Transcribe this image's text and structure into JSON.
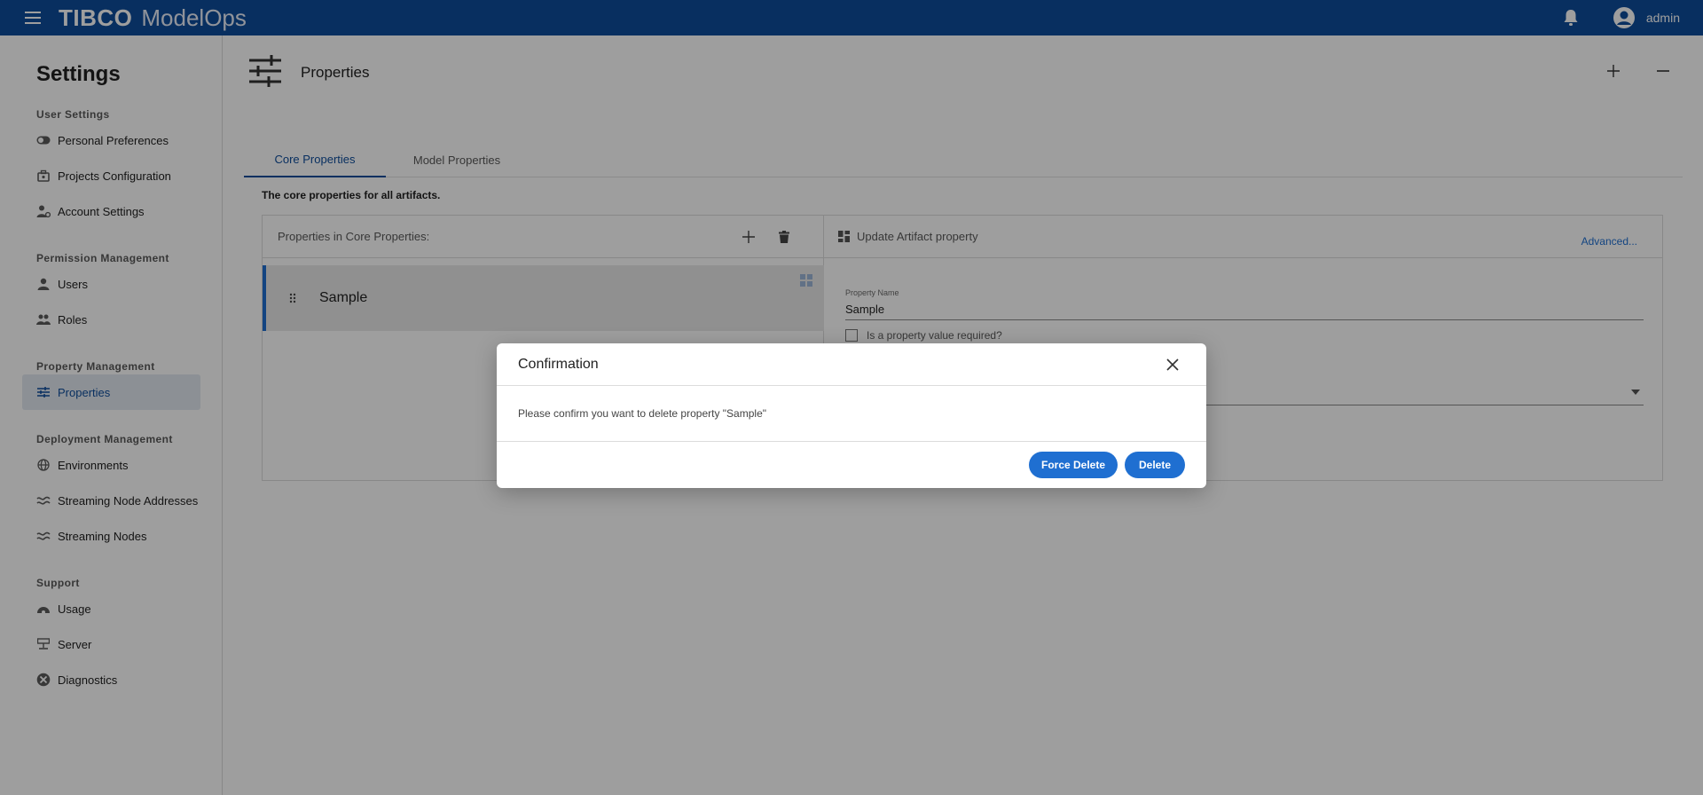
{
  "topbar": {
    "brand": "TIBCO",
    "product": "ModelOps",
    "user_name": "admin"
  },
  "sidebar": {
    "title": "Settings",
    "sections": [
      {
        "heading": "User Settings",
        "items": [
          {
            "label": "Personal Preferences",
            "icon": "toggle-icon"
          },
          {
            "label": "Projects Configuration",
            "icon": "briefcase-icon"
          },
          {
            "label": "Account Settings",
            "icon": "user-gear-icon"
          }
        ]
      },
      {
        "heading": "Permission Management",
        "items": [
          {
            "label": "Users",
            "icon": "person-icon"
          },
          {
            "label": "Roles",
            "icon": "people-icon"
          }
        ]
      },
      {
        "heading": "Property Management",
        "items": [
          {
            "label": "Properties",
            "icon": "sliders-icon",
            "active": true
          }
        ]
      },
      {
        "heading": "Deployment Management",
        "items": [
          {
            "label": "Environments",
            "icon": "globe-icon"
          },
          {
            "label": "Streaming Node Addresses",
            "icon": "wave-icon"
          },
          {
            "label": "Streaming Nodes",
            "icon": "wave-icon"
          }
        ]
      },
      {
        "heading": "Support",
        "items": [
          {
            "label": "Usage",
            "icon": "gauge-icon"
          },
          {
            "label": "Server",
            "icon": "server-icon"
          },
          {
            "label": "Diagnostics",
            "icon": "diagnostics-icon"
          }
        ]
      }
    ]
  },
  "main": {
    "page_title": "Properties",
    "tabs": [
      {
        "label": "Core Properties",
        "active": true
      },
      {
        "label": "Model Properties",
        "active": false
      }
    ],
    "description": "The core properties for all artifacts.",
    "left_panel": {
      "heading": "Properties in Core Properties:",
      "items": [
        {
          "label": "Sample",
          "selected": true
        }
      ]
    },
    "right_panel": {
      "heading": "Update Artifact property",
      "advanced_link": "Advanced...",
      "property_name_label": "Property Name",
      "property_name_value": "Sample",
      "required_checkbox_label": "Is a property value required?"
    }
  },
  "dialog": {
    "title": "Confirmation",
    "message": "Please confirm you want to delete property \"Sample\"",
    "force_delete_label": "Force Delete",
    "delete_label": "Delete"
  },
  "colors": {
    "topbar": "#0e4d9c",
    "accent": "#1f6fd1",
    "overlay": "rgba(0,0,0,0.38)"
  }
}
